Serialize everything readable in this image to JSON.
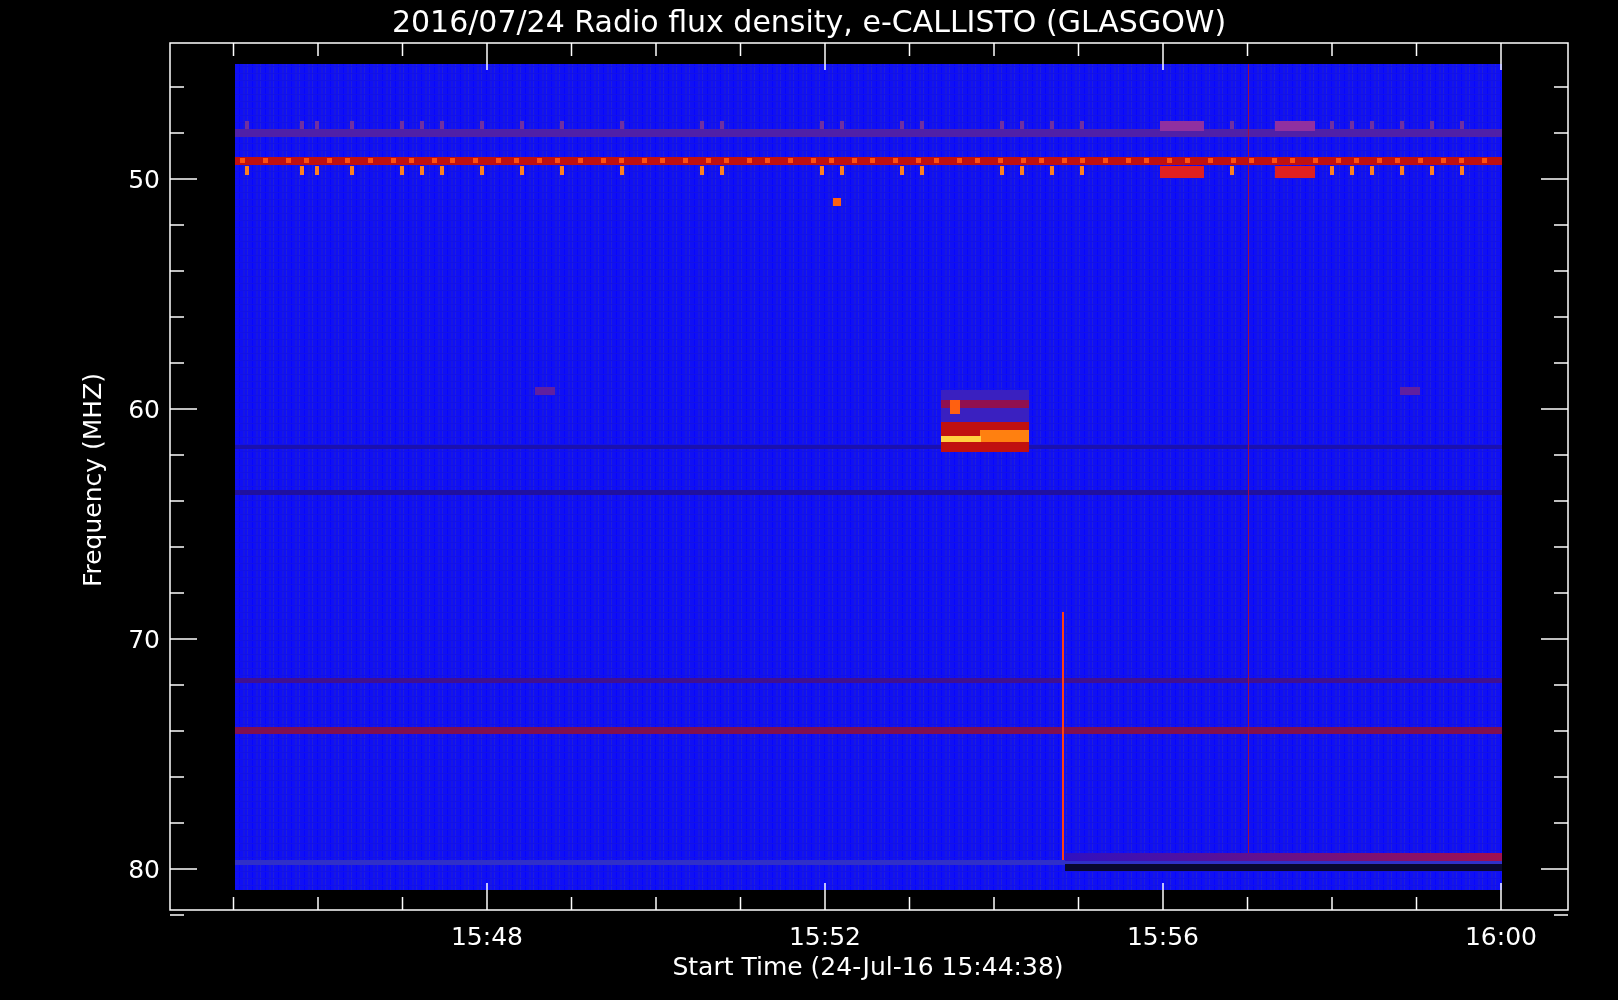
{
  "title": "2016/07/24  Radio flux density, e-CALLISTO (GLASGOW)",
  "y_axis": {
    "label": "Frequency (MHZ)",
    "ticks": [
      "50",
      "60",
      "70",
      "80"
    ]
  },
  "x_axis": {
    "label": "Start Time (24-Jul-16 15:44:38)",
    "ticks": [
      "15:48",
      "15:52",
      "15:56",
      "16:00"
    ]
  }
}
